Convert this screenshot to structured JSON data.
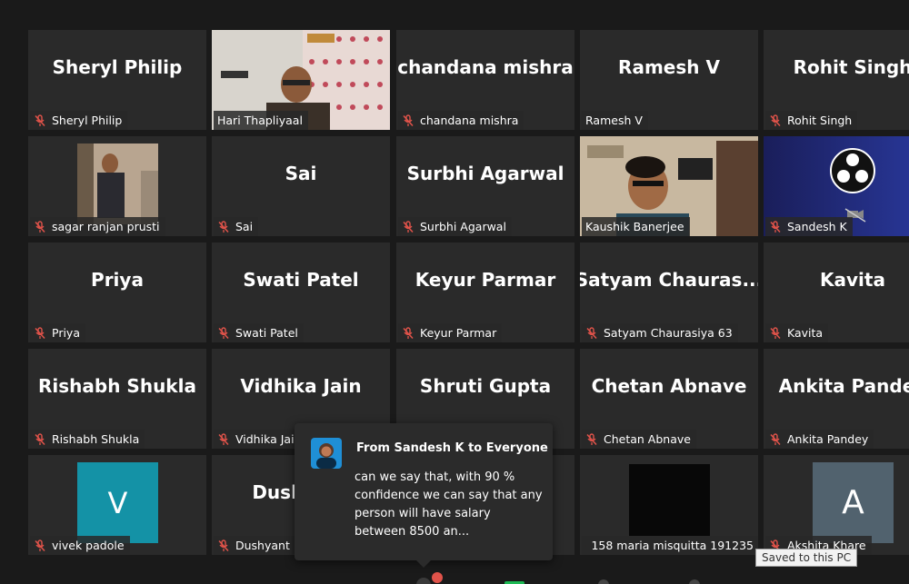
{
  "meeting": {
    "participants": [
      {
        "display": "Sheryl Philip",
        "label": "Sheryl Philip",
        "muted": true,
        "kind": "name"
      },
      {
        "display": "",
        "label": "Hari Thapliyaal",
        "muted": false,
        "kind": "video-hari"
      },
      {
        "display": "chandana mishra",
        "label": "chandana mishra",
        "muted": true,
        "kind": "name"
      },
      {
        "display": "Ramesh V",
        "label": "Ramesh V",
        "muted": false,
        "kind": "name"
      },
      {
        "display": "Rohit Singh",
        "label": "Rohit Singh",
        "muted": true,
        "kind": "name"
      },
      {
        "display": "",
        "label": "sagar ranjan prusti",
        "muted": true,
        "kind": "photo-sagar"
      },
      {
        "display": "Sai",
        "label": "Sai",
        "muted": true,
        "kind": "name"
      },
      {
        "display": "Surbhi Agarwal",
        "label": "Surbhi Agarwal",
        "muted": true,
        "kind": "name"
      },
      {
        "display": "",
        "label": "Kaushik Banerjee",
        "muted": false,
        "kind": "video-kaushik"
      },
      {
        "display": "",
        "label": "Sandesh K",
        "muted": true,
        "kind": "obs"
      },
      {
        "display": "Priya",
        "label": "Priya",
        "muted": true,
        "kind": "name"
      },
      {
        "display": "Swati Patel",
        "label": "Swati Patel",
        "muted": true,
        "kind": "name"
      },
      {
        "display": "Keyur Parmar",
        "label": "Keyur Parmar",
        "muted": true,
        "kind": "name"
      },
      {
        "display": "Satyam  Chauras...",
        "label": "Satyam Chaurasiya 63",
        "muted": true,
        "kind": "name"
      },
      {
        "display": "Kavita",
        "label": "Kavita",
        "muted": true,
        "kind": "name"
      },
      {
        "display": "Rishabh Shukla",
        "label": "Rishabh Shukla",
        "muted": true,
        "kind": "name"
      },
      {
        "display": "Vidhika Jain",
        "label": "Vidhika Jain",
        "muted": true,
        "kind": "name"
      },
      {
        "display": "Shruti Gupta",
        "label": "",
        "muted": false,
        "kind": "name"
      },
      {
        "display": "Chetan Abnave",
        "label": "Chetan Abnave",
        "muted": true,
        "kind": "name"
      },
      {
        "display": "Ankita Pandey",
        "label": "Ankita Pandey",
        "muted": true,
        "kind": "name"
      },
      {
        "display": "V",
        "label": "vivek padole",
        "muted": true,
        "kind": "avatar-v"
      },
      {
        "display": "Dushyant",
        "label": "Dushyant P",
        "muted": true,
        "kind": "name"
      },
      {
        "display": "",
        "label": "",
        "muted": false,
        "kind": "empty"
      },
      {
        "display": "",
        "label": "158 maria misquitta 191235",
        "muted": true,
        "kind": "black"
      },
      {
        "display": "A",
        "label": "Akshita Khare",
        "muted": true,
        "kind": "avatar-a"
      }
    ]
  },
  "chat": {
    "sender_line": "From Sandesh K to Everyone",
    "message": "can we say that, with 90 % confidence we can say that any person will have salary between 8500 an..."
  },
  "toast": {
    "text": "Saved to this PC"
  },
  "colors": {
    "active_speaker_border": "#c8e27a",
    "muted_mic": "#e0534a",
    "tile_bg": "#2a2a2a",
    "page_bg": "#1a1a1a"
  }
}
